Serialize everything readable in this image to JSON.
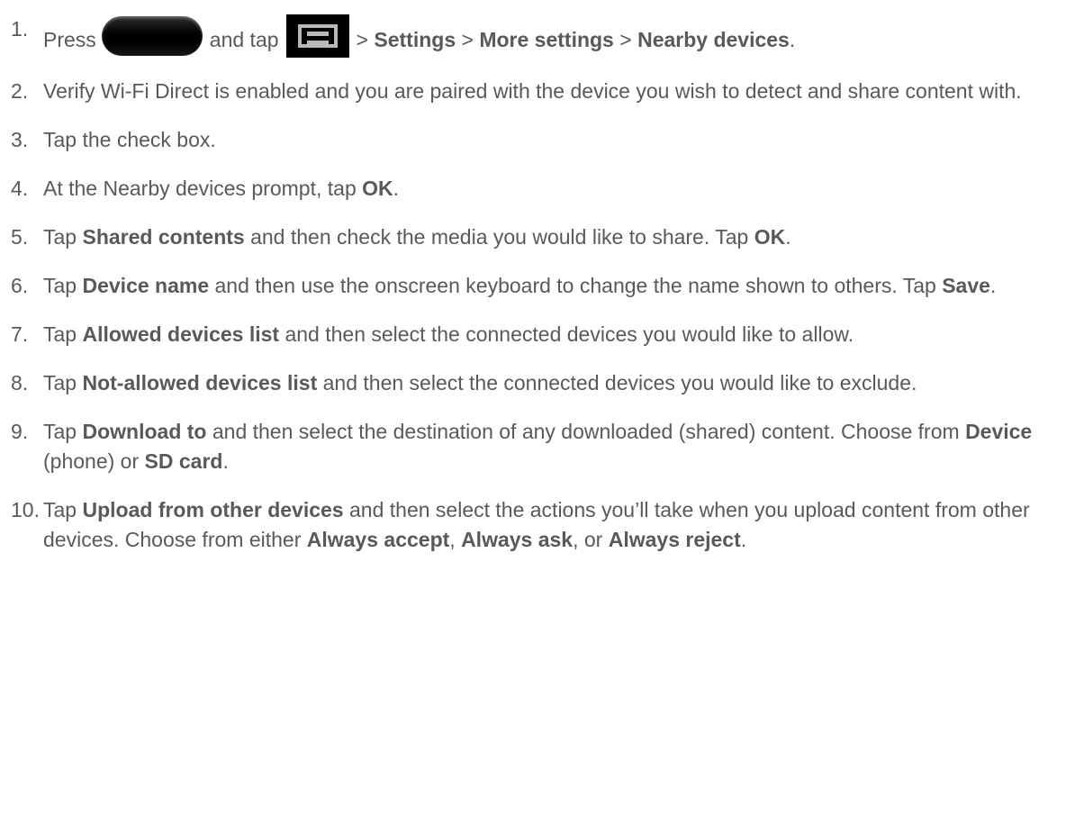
{
  "steps": [
    {
      "num": "1.",
      "parts": {
        "t1": "Press",
        "t2": "and tap",
        "sep1": ">",
        "b1": "Settings",
        "sep2": ">",
        "b2": "More settings",
        "sep3": ">",
        "b3": "Nearby devices",
        "end": "."
      },
      "icons": [
        "home-button-icon",
        "menu-button-icon"
      ]
    },
    {
      "num": "2.",
      "text": "Verify Wi-Fi Direct is enabled and you are paired with the device you wish to detect and share content with."
    },
    {
      "num": "3.",
      "text": "Tap the check box."
    },
    {
      "num": "4.",
      "parts": {
        "t1": "At the Nearby devices prompt, tap",
        "b1": "OK",
        "end": "."
      }
    },
    {
      "num": "5.",
      "parts": {
        "t1": "Tap",
        "b1": "Shared contents",
        "t2": "and then check the media you would like to share. Tap",
        "b2": "OK",
        "end": "."
      }
    },
    {
      "num": "6.",
      "parts": {
        "t1": "Tap",
        "b1": "Device name",
        "t2": "and then use the onscreen keyboard to change the name shown to others. Tap",
        "b2": "Save",
        "end": "."
      }
    },
    {
      "num": "7.",
      "parts": {
        "t1": "Tap",
        "b1": "Allowed devices list",
        "t2": "and then select the connected devices you would like to allow."
      }
    },
    {
      "num": "8.",
      "parts": {
        "t1": "Tap",
        "b1": "Not-allowed devices list",
        "t2": "and then select the connected devices you would like to exclude."
      }
    },
    {
      "num": "9.",
      "parts": {
        "t1": "Tap",
        "b1": "Download to",
        "t2": "and then select the destination of any downloaded (shared) content. Choose from",
        "b2": "Device",
        "t3": "(phone) or",
        "b3": "SD card",
        "end": "."
      }
    },
    {
      "num": "10.",
      "parts": {
        "t1": "Tap",
        "b1": "Upload from other devices",
        "t2": "and then select the actions you’ll take when you upload content from other devices. Choose from either",
        "b2": "Always accept",
        "t3": ",",
        "b3": "Always ask",
        "t4": ", or",
        "b4": "Always reject",
        "end": "."
      }
    }
  ]
}
